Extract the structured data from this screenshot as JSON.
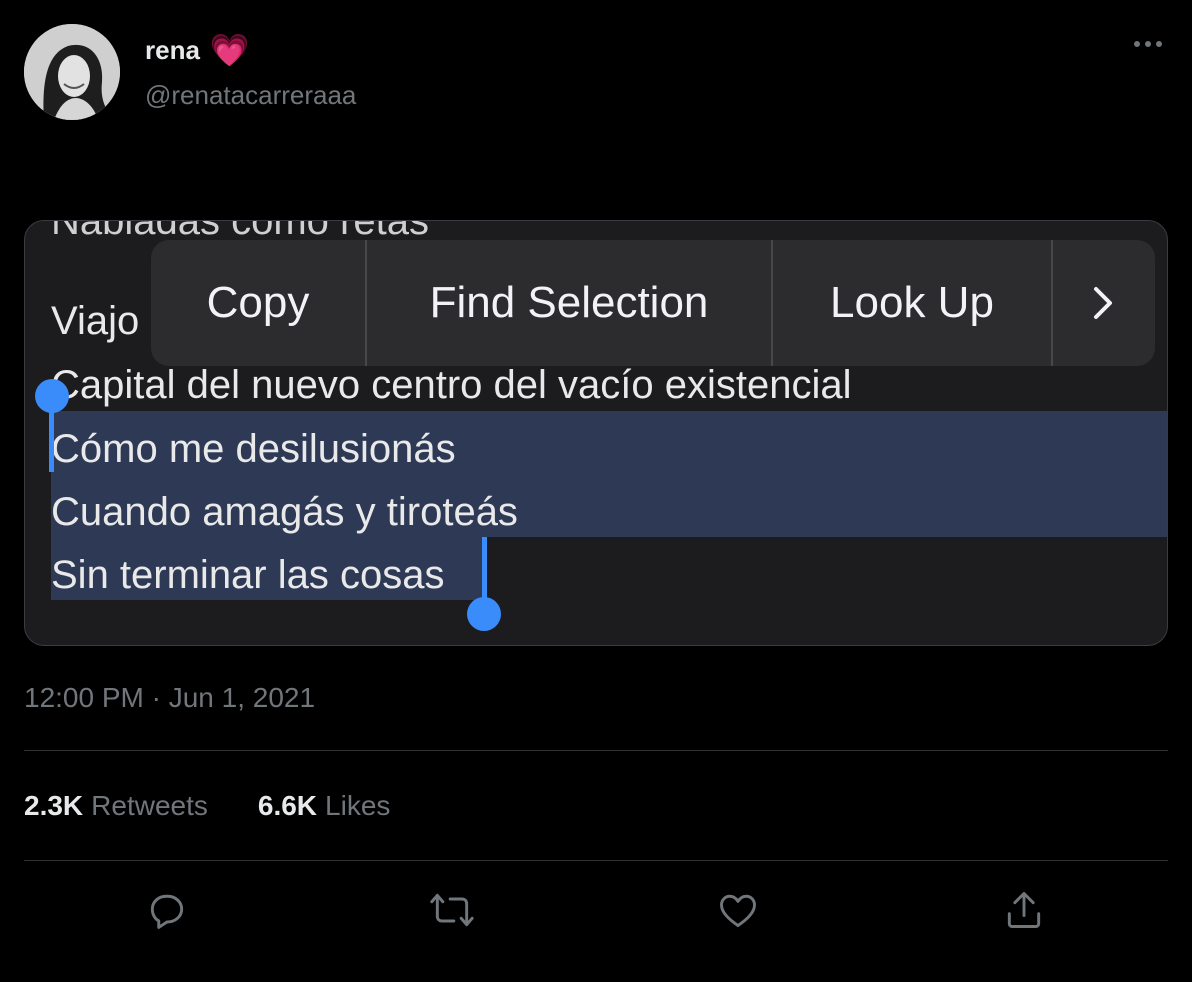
{
  "author": {
    "display_name": "rena",
    "emoji": "💗",
    "handle": "@renatacarreraaa"
  },
  "media": {
    "partial_top_line": "Nabiadas como retas",
    "lines": [
      "Viajo",
      "Capital del nuevo centro del vacío existencial",
      "Cómo me desilusionás",
      "Cuando amagás y tiroteás",
      "Sin terminar las cosas"
    ],
    "context_menu": [
      "Copy",
      "Find Selection",
      "Look Up"
    ],
    "context_menu_more": "›"
  },
  "timestamp": "12:00 PM · Jun 1, 2021",
  "stats": {
    "retweets_count": "2.3K",
    "retweets_label": "Retweets",
    "likes_count": "6.6K",
    "likes_label": "Likes"
  },
  "colors": {
    "background": "#000000",
    "selection": "#2e3a55",
    "handle": "#3b8cfb",
    "muted": "#71767b"
  },
  "icons": [
    "reply-icon",
    "retweet-icon",
    "like-icon",
    "share-icon",
    "more-icon"
  ]
}
